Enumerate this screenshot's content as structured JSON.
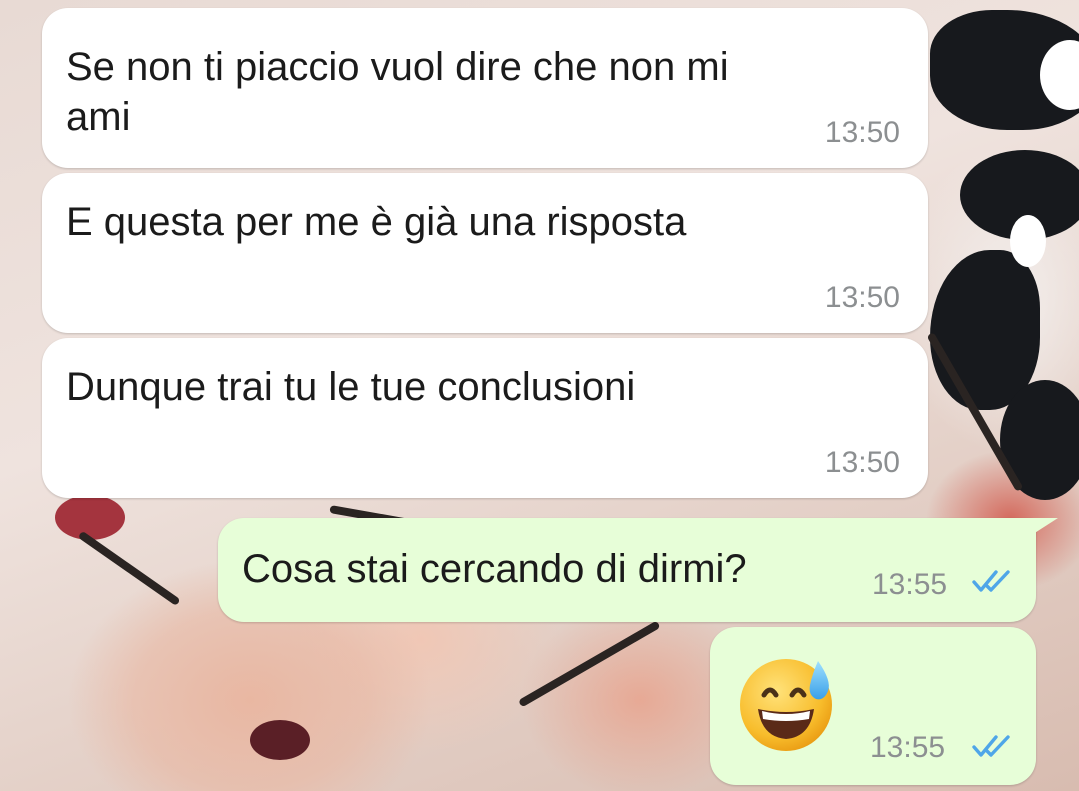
{
  "conversation": {
    "messages": [
      {
        "direction": "incoming",
        "text": "Se non ti piaccio vuol dire che non mi ami",
        "line1": "Se non ti piaccio vuol dire che non mi",
        "line2": "ami",
        "time": "13:50"
      },
      {
        "direction": "incoming",
        "text": "E questa per me è già una risposta",
        "time": "13:50"
      },
      {
        "direction": "incoming",
        "text": "Dunque trai tu le tue conclusioni",
        "time": "13:50"
      },
      {
        "direction": "outgoing",
        "text": "Cosa stai cercando di dirmi?",
        "time": "13:55",
        "status_icon": "double-check-read-icon"
      },
      {
        "direction": "outgoing",
        "emoji": "grinning-face-with-sweat-emoji",
        "time": "13:55",
        "status_icon": "double-check-read-icon"
      }
    ]
  },
  "colors": {
    "incoming_bubble": "#ffffff",
    "outgoing_bubble": "#e7fed8",
    "read_ticks": "#4fa6e8",
    "timestamp": "#8c8f91"
  }
}
